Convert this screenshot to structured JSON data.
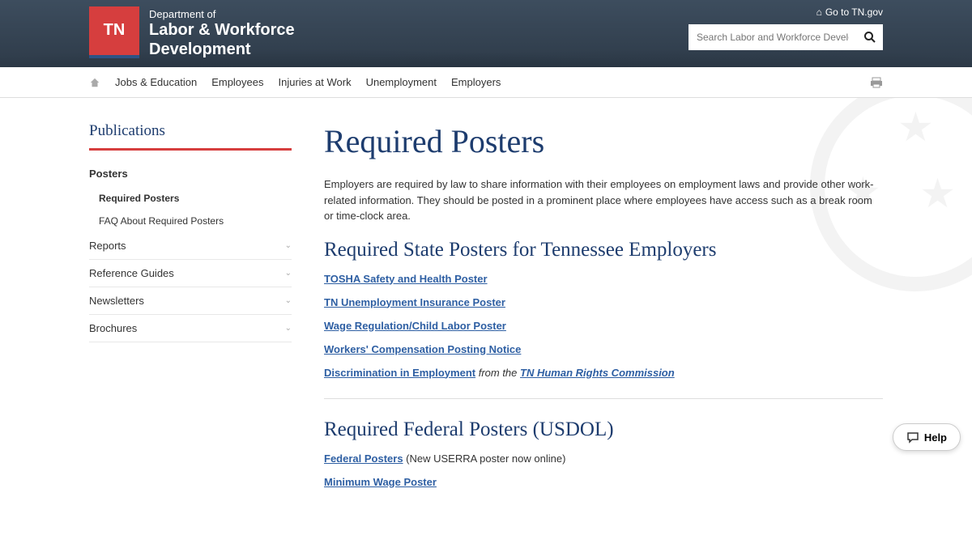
{
  "header": {
    "tn_logo": "TN",
    "dept_line1": "Department of",
    "dept_line2": "Labor & Workforce",
    "dept_line3": "Development",
    "tn_gov_link": "Go to TN.gov",
    "search_placeholder": "Search Labor and Workforce Development"
  },
  "nav": {
    "items": [
      "Jobs & Education",
      "Employees",
      "Injuries at Work",
      "Unemployment",
      "Employers"
    ]
  },
  "sidebar": {
    "title": "Publications",
    "posters_label": "Posters",
    "sub": [
      "Required Posters",
      "FAQ About Required Posters"
    ],
    "collapsible": [
      "Reports",
      "Reference Guides",
      "Newsletters",
      "Brochures"
    ]
  },
  "content": {
    "h1": "Required Posters",
    "intro": "Employers are required by law to share information with their employees on employment laws and provide other work-related information. They should be posted in a prominent place where employees have access such as a break room or time-clock area.",
    "h2_state": "Required State Posters  for Tennessee Employers",
    "state_links": [
      "TOSHA Safety and Health Poster",
      "TN Unemployment Insurance Poster",
      "Wage Regulation/Child Labor Poster",
      "Workers' Compensation Posting Notice"
    ],
    "discrimination_link": "Discrimination in Employment",
    "discrimination_from": " from the ",
    "discrimination_commission": "TN Human Rights Commission",
    "h2_federal": "Required Federal Posters (USDOL)",
    "federal_link": "Federal Posters",
    "federal_note": " (New USERRA poster now online)",
    "minwage_link": "Minimum Wage Poster"
  },
  "help": {
    "label": "Help"
  }
}
